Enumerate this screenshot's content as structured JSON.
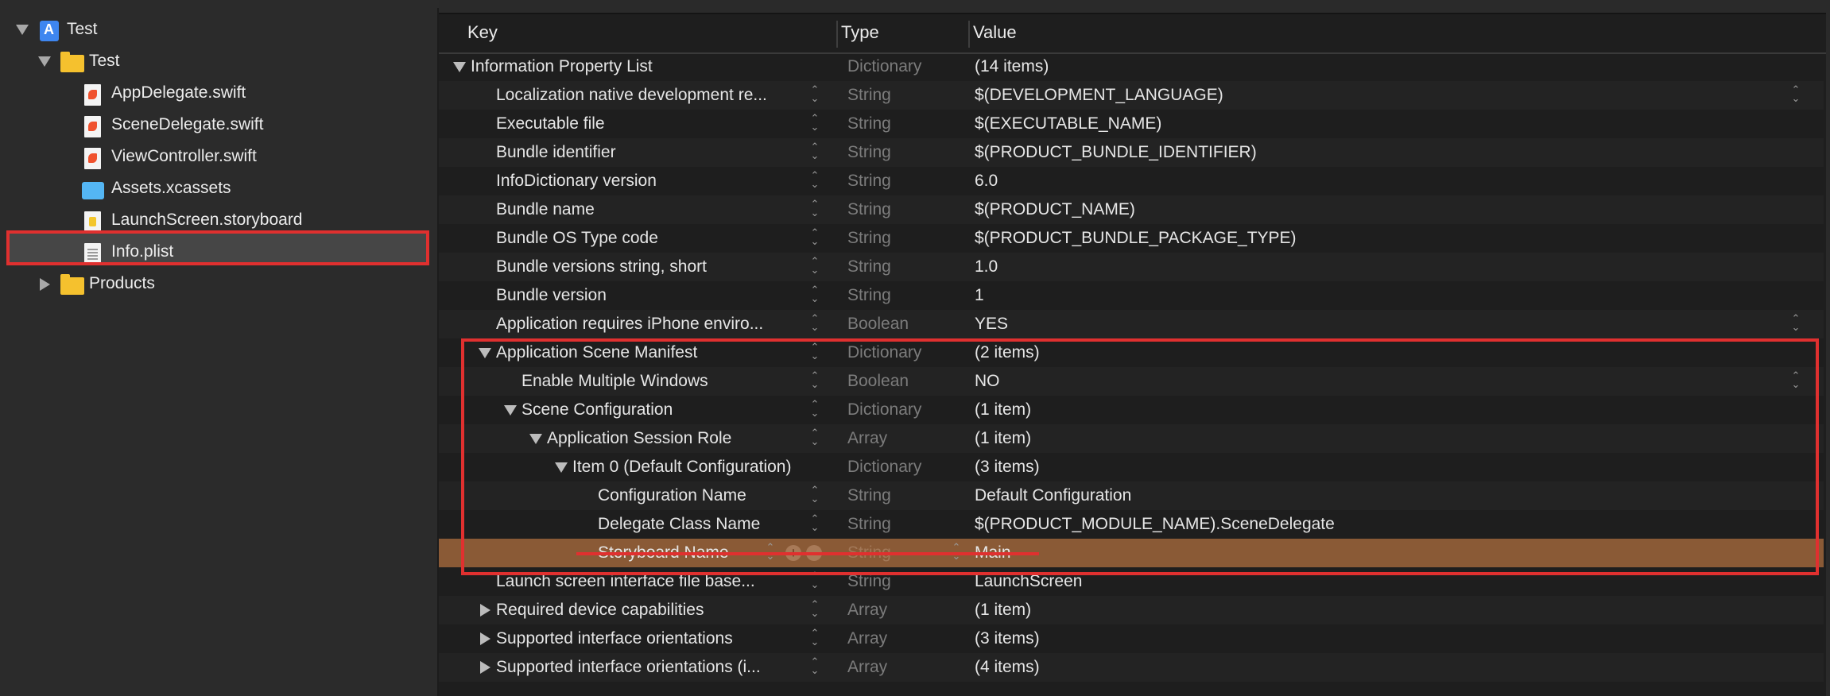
{
  "navigator": {
    "items": [
      {
        "label": "Test",
        "type": "project"
      },
      {
        "label": "Test",
        "type": "folder"
      },
      {
        "label": "AppDelegate.swift",
        "type": "swift"
      },
      {
        "label": "SceneDelegate.swift",
        "type": "swift"
      },
      {
        "label": "ViewController.swift",
        "type": "swift"
      },
      {
        "label": "Assets.xcassets",
        "type": "assets"
      },
      {
        "label": "LaunchScreen.storyboard",
        "type": "storyboard"
      },
      {
        "label": "Info.plist",
        "type": "plist",
        "selected": true
      },
      {
        "label": "Products",
        "type": "folder"
      }
    ]
  },
  "editor": {
    "columns": {
      "key": "Key",
      "type": "Type",
      "value": "Value"
    },
    "rows": [
      {
        "key": "Information Property List",
        "type": "Dictionary",
        "value": "(14 items)"
      },
      {
        "key": "Localization native development re...",
        "type": "String",
        "value": "$(DEVELOPMENT_LANGUAGE)"
      },
      {
        "key": "Executable file",
        "type": "String",
        "value": "$(EXECUTABLE_NAME)"
      },
      {
        "key": "Bundle identifier",
        "type": "String",
        "value": "$(PRODUCT_BUNDLE_IDENTIFIER)"
      },
      {
        "key": "InfoDictionary version",
        "type": "String",
        "value": "6.0"
      },
      {
        "key": "Bundle name",
        "type": "String",
        "value": "$(PRODUCT_NAME)"
      },
      {
        "key": "Bundle OS Type code",
        "type": "String",
        "value": "$(PRODUCT_BUNDLE_PACKAGE_TYPE)"
      },
      {
        "key": "Bundle versions string, short",
        "type": "String",
        "value": "1.0"
      },
      {
        "key": "Bundle version",
        "type": "String",
        "value": "1"
      },
      {
        "key": "Application requires iPhone enviro...",
        "type": "Boolean",
        "value": "YES"
      },
      {
        "key": "Application Scene Manifest",
        "type": "Dictionary",
        "value": "(2 items)"
      },
      {
        "key": "Enable Multiple Windows",
        "type": "Boolean",
        "value": "NO"
      },
      {
        "key": "Scene Configuration",
        "type": "Dictionary",
        "value": "(1 item)"
      },
      {
        "key": "Application Session Role",
        "type": "Array",
        "value": "(1 item)"
      },
      {
        "key": "Item 0 (Default Configuration)",
        "type": "Dictionary",
        "value": "(3 items)"
      },
      {
        "key": "Configuration Name",
        "type": "String",
        "value": "Default Configuration"
      },
      {
        "key": "Delegate Class Name",
        "type": "String",
        "value": "$(PRODUCT_MODULE_NAME).SceneDelegate"
      },
      {
        "key": "Storyboard Name",
        "type": "String",
        "value": "Main"
      },
      {
        "key": "Launch screen interface file base...",
        "type": "String",
        "value": "LaunchScreen"
      },
      {
        "key": "Required device capabilities",
        "type": "Array",
        "value": "(1 item)"
      },
      {
        "key": "Supported interface orientations",
        "type": "Array",
        "value": "(3 items)"
      },
      {
        "key": "Supported interface orientations (i...",
        "type": "Array",
        "value": "(4 items)"
      }
    ]
  },
  "colors": {
    "highlight": "#e0302f",
    "selected_row": "#8a5a36",
    "folder": "#f5c12e"
  }
}
